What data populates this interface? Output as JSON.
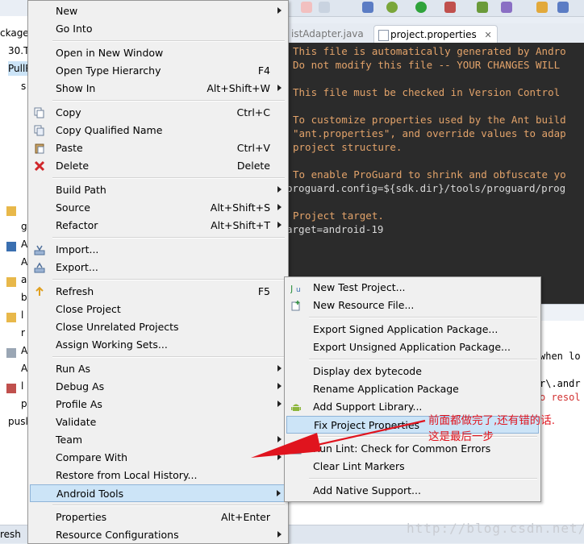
{
  "editor": {
    "tabs": {
      "inactive": "istAdapter.java",
      "active": "project.properties"
    },
    "lines": [
      "This file is automatically generated by Andro",
      "Do not modify this file -- YOUR CHANGES WILL",
      "",
      "This file must be checked in Version Control",
      "",
      "To customize properties used by the Ant build",
      "\"ant.properties\", and override values to adap",
      "project structure.",
      "",
      "To enable ProGuard to shrink and obfuscate yo",
      "proguard.config=${sdk.dir}/tools/proguard/prog",
      "",
      "Project target.",
      "arget=android-19"
    ]
  },
  "console": {
    "lines": [
      "when lo",
      "",
      "r\\.andr",
      "o resol"
    ]
  },
  "explorer": {
    "items": [
      "ckage",
      "30.T",
      "PullR",
      "s",
      "",
      "",
      "",
      "",
      "",
      "g",
      "A",
      "A",
      "a",
      "b",
      "l",
      "r",
      "A",
      "A",
      "l",
      "p",
      "p",
      "pusl"
    ]
  },
  "status": {
    "left": "resh"
  },
  "watermark": "http://blog.csdn.net/",
  "menu": {
    "groups": [
      [
        {
          "label": "New",
          "accel": "",
          "submenu": true
        },
        {
          "label": "Go Into",
          "accel": "",
          "submenu": false
        }
      ],
      [
        {
          "label": "Open in New Window",
          "accel": "",
          "submenu": false
        },
        {
          "label": "Open Type Hierarchy",
          "accel": "F4",
          "submenu": false
        },
        {
          "label": "Show In",
          "accel": "Alt+Shift+W",
          "submenu": true
        }
      ],
      [
        {
          "label": "Copy",
          "accel": "Ctrl+C",
          "submenu": false,
          "icon": "copy-icon"
        },
        {
          "label": "Copy Qualified Name",
          "accel": "",
          "submenu": false,
          "icon": "copy-qualified-icon"
        },
        {
          "label": "Paste",
          "accel": "Ctrl+V",
          "submenu": false,
          "icon": "paste-icon"
        },
        {
          "label": "Delete",
          "accel": "Delete",
          "submenu": false,
          "icon": "delete-icon"
        }
      ],
      [
        {
          "label": "Build Path",
          "accel": "",
          "submenu": true
        },
        {
          "label": "Source",
          "accel": "Alt+Shift+S",
          "submenu": true
        },
        {
          "label": "Refactor",
          "accel": "Alt+Shift+T",
          "submenu": true
        }
      ],
      [
        {
          "label": "Import...",
          "accel": "",
          "submenu": false,
          "icon": "import-icon"
        },
        {
          "label": "Export...",
          "accel": "",
          "submenu": false,
          "icon": "export-icon"
        }
      ],
      [
        {
          "label": "Refresh",
          "accel": "F5",
          "submenu": false,
          "icon": "refresh-icon"
        },
        {
          "label": "Close Project",
          "accel": "",
          "submenu": false
        },
        {
          "label": "Close Unrelated Projects",
          "accel": "",
          "submenu": false
        },
        {
          "label": "Assign Working Sets...",
          "accel": "",
          "submenu": false
        }
      ],
      [
        {
          "label": "Run As",
          "accel": "",
          "submenu": true
        },
        {
          "label": "Debug As",
          "accel": "",
          "submenu": true
        },
        {
          "label": "Profile As",
          "accel": "",
          "submenu": true
        },
        {
          "label": "Validate",
          "accel": "",
          "submenu": false
        },
        {
          "label": "Team",
          "accel": "",
          "submenu": true
        },
        {
          "label": "Compare With",
          "accel": "",
          "submenu": true
        },
        {
          "label": "Restore from Local History...",
          "accel": "",
          "submenu": false
        },
        {
          "label": "Android Tools",
          "accel": "",
          "submenu": true,
          "highlighted": true
        }
      ],
      [
        {
          "label": "Properties",
          "accel": "Alt+Enter",
          "submenu": false
        },
        {
          "label": "Resource Configurations",
          "accel": "",
          "submenu": true
        }
      ]
    ]
  },
  "submenu": {
    "groups": [
      [
        {
          "label": "New Test Project...",
          "icon": "junit-icon"
        },
        {
          "label": "New Resource File...",
          "icon": "new-resource-icon"
        }
      ],
      [
        {
          "label": "Export Signed Application Package..."
        },
        {
          "label": "Export Unsigned Application Package..."
        }
      ],
      [
        {
          "label": "Display dex bytecode"
        },
        {
          "label": "Rename Application Package"
        },
        {
          "label": "Add Support Library...",
          "icon": "android-icon"
        },
        {
          "label": "Fix Project Properties",
          "highlighted": true
        }
      ],
      [
        {
          "label": "Run Lint: Check for Common Errors",
          "icon": "lint-check-icon"
        },
        {
          "label": "Clear Lint Markers"
        }
      ],
      [
        {
          "label": "Add Native Support..."
        }
      ]
    ]
  },
  "annotation": "前面都做完了,还有错的话.\n这是最后一步",
  "colors": {
    "highlight": "#cce4f7",
    "annotation": "#e0141e",
    "editor_bg": "#2b2b2b",
    "editor_text": "#e3a36a"
  }
}
